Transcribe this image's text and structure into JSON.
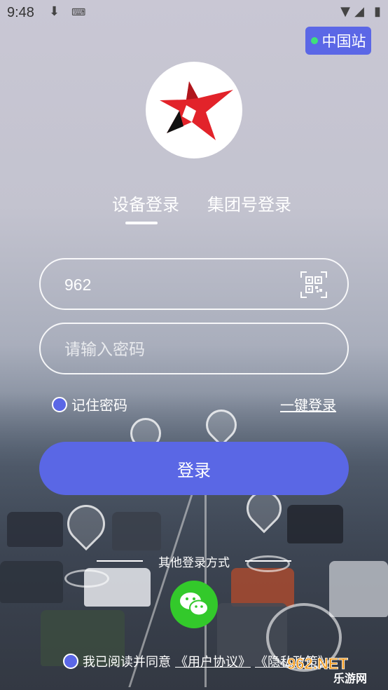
{
  "status_bar": {
    "time": "9:48"
  },
  "site_switch": {
    "label": "中国站"
  },
  "tabs": [
    {
      "label": "设备登录",
      "active": true
    },
    {
      "label": "集团号登录",
      "active": false
    }
  ],
  "form": {
    "device_value": "962",
    "password_placeholder": "请输入密码",
    "remember_label": "记住密码",
    "one_key_login": "一键登录",
    "login_button": "登录"
  },
  "other_login": {
    "title": "其他登录方式"
  },
  "agreement": {
    "prefix": "我已阅读并同意",
    "user_agreement": "《用户协议》",
    "privacy_policy": "《隐私政策》"
  },
  "watermark": {
    "brand": "962.NET",
    "sub": "乐游网"
  },
  "colors": {
    "accent": "#5a67e5",
    "wechat": "#33c92b",
    "online_dot": "#3fe07a"
  }
}
